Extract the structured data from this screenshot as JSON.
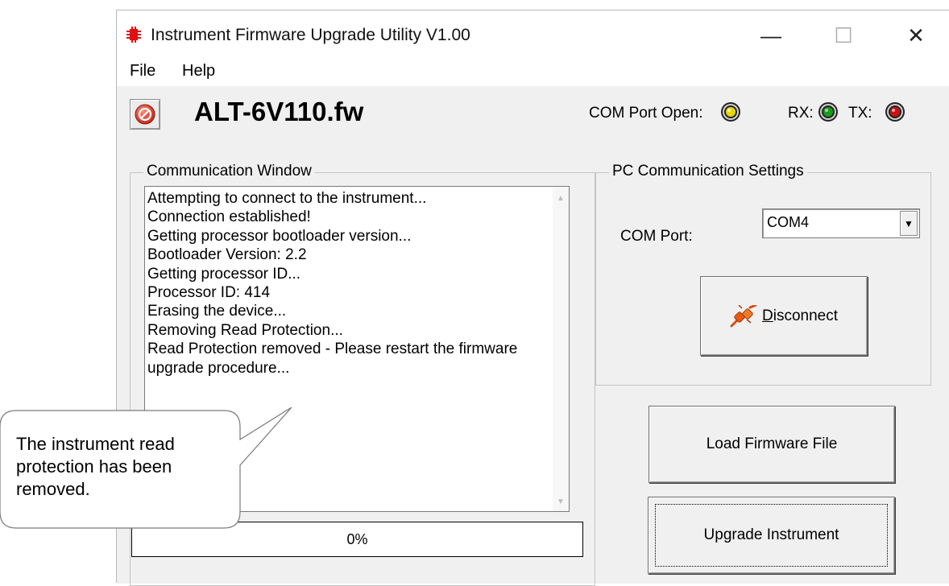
{
  "window": {
    "title": "Instrument Firmware Upgrade Utility V1.00",
    "controls": {
      "minimize": "—",
      "maximize": "☐",
      "close": "✕"
    }
  },
  "menu": [
    "File",
    "Help"
  ],
  "toolbar": {
    "firmware_file": "ALT-6V110.fw",
    "com_port_open_label": "COM Port Open:",
    "rx_label": "RX:",
    "tx_label": "TX:",
    "led_colors": {
      "com_port_open": "#e8d800",
      "rx": "#1a9a1a",
      "tx": "#c81414"
    }
  },
  "communication_window": {
    "title": "Communication Window",
    "log": [
      "Attempting to connect to the instrument...",
      "Connection established!",
      "Getting processor bootloader version...",
      "Bootloader Version: 2.2",
      "Getting processor ID...",
      "Processor ID: 414",
      "Erasing the device...",
      "Removing Read Protection...",
      "Read Protection removed - Please restart the firmware upgrade procedure..."
    ]
  },
  "progress": {
    "text": "0%",
    "value": 0
  },
  "pc_settings": {
    "title": "PC Communication Settings",
    "com_port_label": "COM Port:",
    "com_port_value": "COM4",
    "disconnect_prefix": "D",
    "disconnect_rest": "isconnect"
  },
  "buttons": {
    "load_firmware": "Load Firmware File",
    "upgrade_instrument": "Upgrade Instrument"
  },
  "callout": {
    "text": "The instrument read\n protection has been\n removed."
  }
}
